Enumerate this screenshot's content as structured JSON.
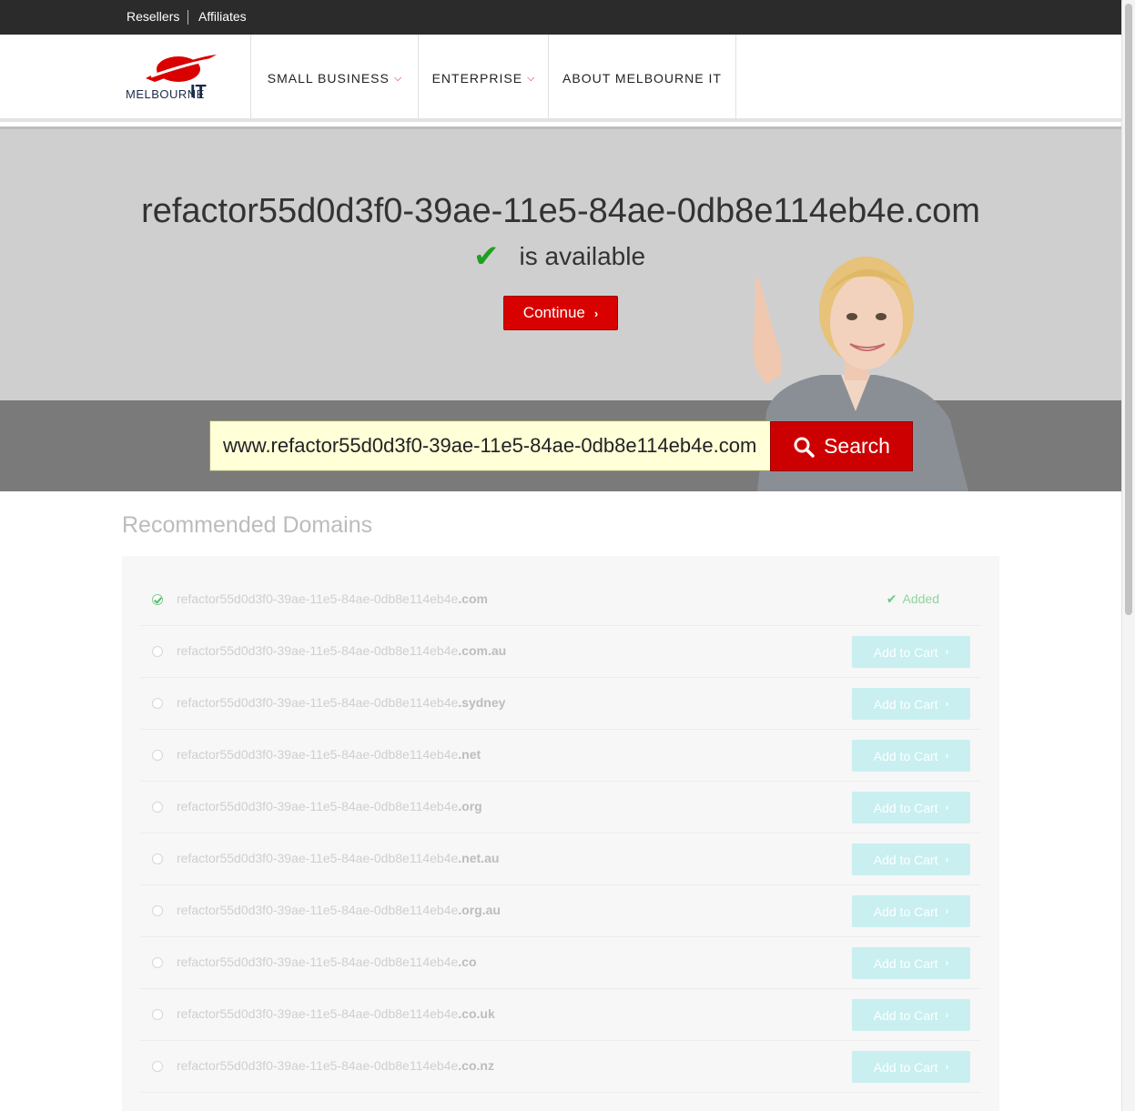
{
  "topbar": {
    "resellers": "Resellers",
    "affiliates": "Affiliates"
  },
  "nav": {
    "small_business": "SMALL BUSINESS",
    "enterprise": "ENTERPRISE",
    "about": "ABOUT MELBOURNE IT",
    "chevron": "⌵"
  },
  "logo": {
    "text_left": "MELBOURNE",
    "text_right": "IT"
  },
  "hero": {
    "domain": "refactor55d0d3f0-39ae-11e5-84ae-0db8e114eb4e.com",
    "check": "✔",
    "status": "is available",
    "continue_label": "Continue",
    "arrow": "›"
  },
  "search": {
    "value": "www.refactor55d0d3f0-39ae-11e5-84ae-0db8e114eb4e.com",
    "button_label": "Search"
  },
  "recommended": {
    "title": "Recommended Domains",
    "base": "refactor55d0d3f0-39ae-11e5-84ae-0db8e114eb4e",
    "added_label": "Added",
    "added_tick": "✔",
    "cart_label": "Add to Cart",
    "cart_arrow": "›",
    "tlds": [
      ".com",
      ".com.au",
      ".sydney",
      ".net",
      ".org",
      ".net.au",
      ".org.au",
      ".co",
      ".co.uk",
      ".co.nz"
    ]
  },
  "colors": {
    "brand_red": "#d90000",
    "topbar": "#2b2b2b",
    "hero_bg": "#cfcfcf",
    "search_band": "#7a7a7a",
    "cart_button": "#c9eff0",
    "available_green": "#1fa01f"
  }
}
